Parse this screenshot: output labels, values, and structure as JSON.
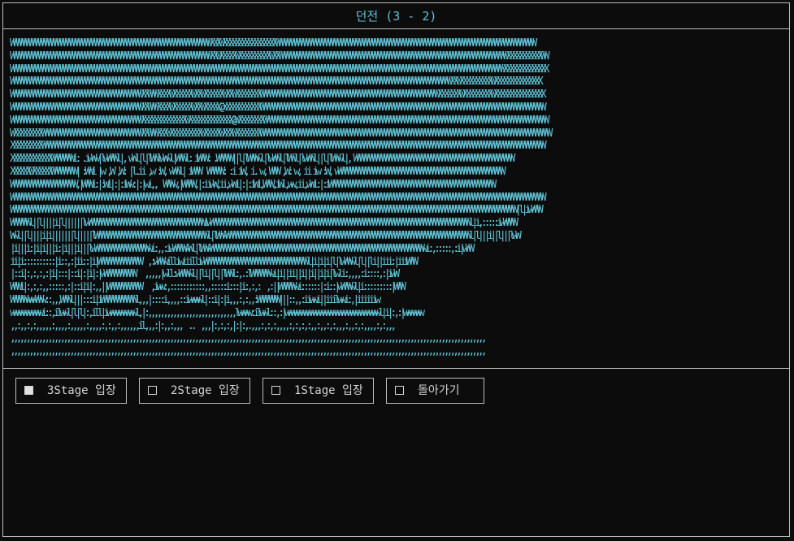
{
  "window": {
    "title": "던전 (3 - 2)"
  },
  "art": {
    "color": "#62c6d8",
    "lines": [
      "WWWWWWWWWWWWWWWWWWWWWWWWWWWWWWWWWWWWWWWWWWWWWWWWWWWWWWWWWWWWWWWWXXXWXXXXXXXXXXXXXXXXXWWWWWWWWWWWWWWWWWWWWWWWWWWWWWWWWWWWWWWWWWWWWWWWWWWWWWWWWWWWWWWWWWWWWWWWWWWWWWWWWWWW",
      "WWWWWWWWWWWWWWWWWWWWWWWWWWWWWWWWWWWWWWWWWWWWWWWWWWWWWWWWWWWWWWWWXXWXXXXXWXXXXXXXXXXWXXWWWWWWWWWWWWWWWWWWWWWWWWWWWWWWWWWWWWWWWWWWWWWWWWWWWWWWWWWWWWWWWWWWWWWWWWWXXXXXXXXXXXWW",
      "WWWWWWWWWWWWWWWWWWWWWWWWWWWWWWWWWWWWWWWWWWWWWWWWWWWWWWWWWWWWWWWWWWWWWWWWWWWWWWWWWWWWWWWWWWWWWWWWWWWWWWWWWWWWWWWWWWWWWWWWWWWWWWWWWWWWWWWWWWWWWWWWWWWWWWWWWWWWWWXXXXXXXXXXXXXX",
      "WWWWWWWWWWWWWWWWWWWWWWWWWWWWWWWWWWWWWWWWWWWWWWWWWWWWWWWWWWWWWWWWWWWWWWWWWWWWWWWWWWWWWWWWWWWWWWWWWWWWWWWWWWWWWWWWWWWWWWWWWWWWWWWWWWWWWWWWWWWWWXXWXXXXXXXXXXWXXXXXXXXXXXXXXX",
      "WWWWWWWWWWWWWWWWWWWWWWWWWWWWWWWWWWWWWWWWWWXXWWWXXXXWXXXXXXWXXWXXXXXXWXXWXXXXXXXXWWWWWWWWWWWWWWWWWWWWWWWWWWWWWWWWWWWWWWWWWWWWWWWWWWWWWWWWWXXXXXXXWXXXXXXXXXWXXXXXXXXXXXXXXXX",
      "WWWWWWWWWWWWWWWWWWWWWWWWWWWWWWWWWWWWWWWWWWXXWWWXXXXWXXXXXXWXXWXXXXX@XXXXXXXXXXXXWWWWWWWWWWWWWWWWWWWWWWWWWWWWWWWWWWWWWWWWWWWWWWWWWWWWWWWWWWWWWWWWWWWWWWWWWWWWWWWWWWWWWWWWWWW",
      "WWWWWWWWWWWWWWWWWWWWWWWWWWWWWWWWWWWWWWWWWWXXXXXXXXXXXXXXWXXXXXXXXXXXXXX@WXXXXXXXXWWWWWWWWWWWWWWWWWWWWWWWWWWWWWWWWWWWWWWWWWWWWWWWWWWWWWWWWWWWWWWWWWWWWWWWWWWWWWWWWWWWWWWWWWWW",
      "WXXXXXXXXXWWWWWWWWWWWWWWWWWWWWWWWWWWWWWWWWXXWWWXXXWXXXXXXXXXXWXXXXXWXXXWXXXXXXXXWWWWWWWWWWWWWWWWWWWWWWWWWWWWWWWWWWWWWWWWWWWWWWWWWWWWWWWWWWWWWWWWWWWWWWWWWWWWWWWWWWWWWWWWWWWWW",
      "XXXXXXXXXXWWWWWWWWWWWWWWWWWWWWWWWWWWWWWWWWWWWWWWWWWWWWWWWWWWWWWWWWWWWWWWWWWWWWWWWWWWWWWWWWWWWWWWWWWWWWWWWWWWWWWWWWWWWWWWWWWWWWWWWWWWWWWWWWWWWWWWWWWWWWWWWWWWWWWWWWWWWWWWWWW",
      "XXXXXXXXXXXXXWWWWWWWi: .iwWw|lwWWWl|, wWl|l|lWWlwWwl|WWWl: iWWW: .WWWWW||l|lWWWwl|lwWWl|lWWl|lwWWl||l|lWWwl|, WWWWWWWWWWWWWWWWWWWWWWWWWWWWWWWWWWWWWWWWWWWWWWWWWWW",
      "XXXXXXWXXXXXXWWWWWWWW| :WWi |w ,W ,W: |l.ii ,w :W, wWWl| iWWW  WWWWW: :i iW, i. w, WWW ,W: w, ii iw :W, wWWWWWWWWWWWWWWWWWWWWWWWWWWWWWWWWWWWWWWWWWWWWWWWWWWWWW",
      "WWWWWWWWWWWWWWWWWWWWW,|WWWi:|:Wi|:|:iWw:|:|wi,,  WWWw,|WWWW,|:iiwW,ii,wWi|:|:iWi,WWW,iWl,ww,ii,wWi:|:iWWWWWWWWWWWWWWWWWWWWWWWWWWWWWWWWWWWWWWWWWWWWWWWWWWWWW",
      "WWWWWWWWWWWWWWWWWWWWWWWWWWWWWWWWWWWWWWWWWWWWWWWWWWWWWWWWWWWWWWWWWWWWWWWWWWWWWWWWWWWWWWWWWWWWWWWWWWWWWWWWWWWWWWWWWWWWWWWWWWWWWWWWWWWWWWWWWWWWWWWWWWWWWWWWWWWWWWWWWWWWWWWWWWW",
      "WWWWWWWWWWWWWWWWWWWWWWWWWWWWWWWWWWWWWWWWWWWWWWWWWWWWWWWWWWWWWWWWWWWWWWWWWWWWWWWWWWWWWWWWWWWWWWWWWWWWWWWWWWWWWWWWWWWWWWWWWWWWWWWWWWWWWWWWWWWWWWWWWWWWWWWWWWWWWWWWWW|l|iwWWW",
      "WWWWWWl||l||||i|l||||||lwWWWWWWWWWWWWWWWWWWWWWWWWWWWWWWWWWWWWWiwWWWWWWWWWWWWWWWWWWWWWWWWWWWWWWWWWWWWWWWWWWWWWWWWWWWWWWWWWWWWWWWWWWWWWWWWWWWWWWWWWWWl|i,:::::iwWWWW",
      "Wwl||l||||i|i|||||||l|||||lWWWWWWWWWWWWWWWWWWWWWWWWWWWWWWWWWWWWl|lWWwWWWWWWWWWWWWWWWWWWWWWWWWWWWWWWWWWWWWWWWWWWWWWWWWWWWWWWWWWWWWWWWWWWWWWWWWWWWWWWl|l|||i||l|||lwW",
      "|i|||i:|i|i|||i:|i|||i|||lwWWWWWWWWWWWWWWWWWwi:,,:iwWWWWwWl|lWWwWWWWWWWWWWWWWWWWWWWWWWWWWWWWWWWWWWWWWWWWWWWWWWWWWWWWWWWWWWWWWWWWWWWWwi:,:::::,:i|wWW",
      "ii|i::::::::::|i::,:|ii::|i|WWWWWWWWWWWWWW  ,:wWWwilliwiiilliwWWWWWWWWWWWWWWWWWWWWWWWWWWWWWWWWWl|i|i|i|l|lwWWwl|l||li||iii:|iiiWWW",
      "|::i|:,:,:,:|i|:::|::i|:|i|:|wWWWWWWWWWW   ,,,,,|wll:wWWWwl||li||l||lWWl:,.:lWWWWWWwi|i||ii||i||i||i|i|lwli:,,,,:i::::,:|iwW",
      "WWWi|:,:,:,,:::::,:|::i|i|:,,||WWWWWWWWWWW   ,iww:,:::::::::::,,:::::i:::|i:,:,:  ,:||WWWWWwi::::::|:i::|wWWWwl|i:::::::::|WWW",
      "WWWWWwwwWWw::,,,WWWl|||:::i|iWWWWWWWWWWWl,,,|::::i,,,,::iwwwwl|::i|:|i,,,:,:,,:WWWWWWW|||::,,:iiwwi||iiilwwi:,|iiiiiiw",
      "wwwwwwwwwwi::,ilwwl|l|l|:,ill|iwwwwwwwwwl,|:,,,,,,,,,,,,,,,,,,,,,,,,,,,,lwwww:ilwwl::,:|wwwwwwwwwwwwwwwwwwwwwwwwwwwwwwl|i|:,:|wwwwww",
      ",,:,,:,:,,,,,:,,,,:,,,,,:,,,,:,:,,:,,,,,,il,,,:|:,,:,,,  ..  ,,,|:,:,:,|:|:,.,,,:,:,:,,,,:,:,:,:,,:,,:,:,,,:,,:,:,,,,:,:,,,",
      ",,,,,,,,,,,,,,,,,,,,,,,,,,,,,,,,,,,,,,,,,,,,,,,,,,,,,,,,,,,,,,,,,,,,,,,,,,,,,,,,,,,,,,,,,,,,,,,,,,,,,,,,,,,,,,,,,,,,,,,,,,,,,,,,,,,,,,,,,,,,,,,,,,,,,,,,",
      ",,,,,,,,,,,,,,,,,,,,,,,,,,,,,,,,,,,,,,,,,,,,,,,,,,,,,,,,,,,,,,,,,,,,,,,,,,,,,,,,,,,,,,,,,,,,,,,,,,,,,,,,,,,,,,,,,,,,,,,,,,,,,,,,,,,,,,,,,,,,,,,,,,,,,,,,"
    ]
  },
  "menu": {
    "buttons": [
      {
        "label": "3Stage 입장",
        "selected": true
      },
      {
        "label": "2Stage 입장",
        "selected": false
      },
      {
        "label": "1Stage 입장",
        "selected": false
      },
      {
        "label": "돌아가기",
        "selected": false
      }
    ]
  },
  "colors": {
    "background": "#0c0c0c",
    "border": "#bdbdbd",
    "title": "#5fc3d6",
    "art": "#62c6d8",
    "button_text": "#d4d4d4"
  }
}
